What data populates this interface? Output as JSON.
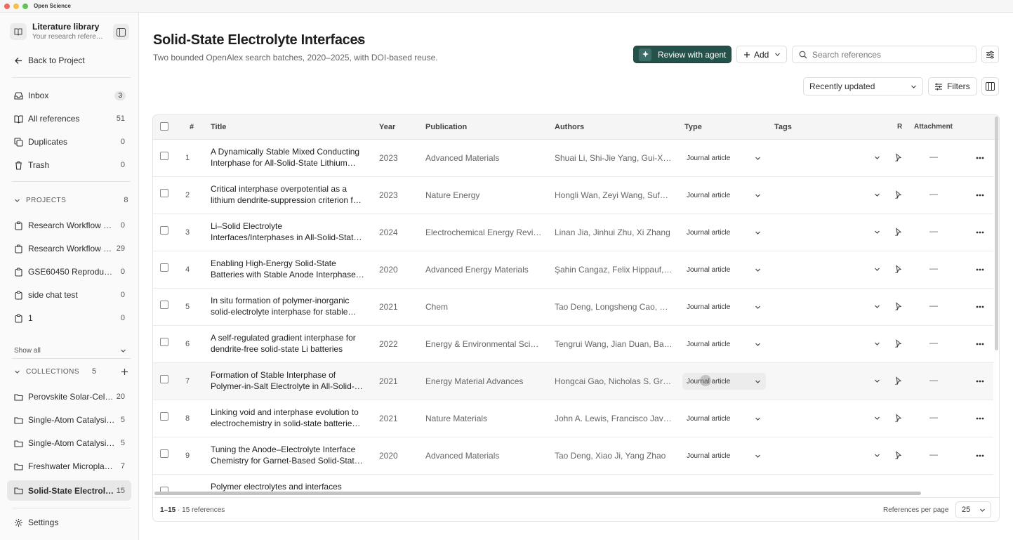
{
  "window": {
    "app_name": "Open Science"
  },
  "sidebar": {
    "library_title": "Literature library",
    "library_subtitle": "Your research refere…",
    "back_label": "Back to Project",
    "nav": [
      {
        "label": "Inbox",
        "count": "3",
        "icon": "inbox-icon"
      },
      {
        "label": "All references",
        "count": "51",
        "icon": "book-icon"
      },
      {
        "label": "Duplicates",
        "count": "0",
        "icon": "copy-icon"
      },
      {
        "label": "Trash",
        "count": "0",
        "icon": "trash-icon"
      }
    ],
    "projects_header": "PROJECTS",
    "projects_count": "8",
    "projects": [
      {
        "label": "Research Workflow E…",
        "count": "0"
      },
      {
        "label": "Research Workflow …",
        "count": "29"
      },
      {
        "label": "GSE60450 Reproduci…",
        "count": "0"
      },
      {
        "label": "side chat test",
        "count": "0"
      },
      {
        "label": "1",
        "count": "0"
      }
    ],
    "show_all": "Show all",
    "collections_header": "COLLECTIONS",
    "collections_count": "5",
    "collections": [
      {
        "label": "Perovskite Solar-Cel…",
        "count": "20"
      },
      {
        "label": "Single-Atom Catalysi…",
        "count": "5"
      },
      {
        "label": "Single-Atom Catalysi…",
        "count": "5"
      },
      {
        "label": "Freshwater Microplas…",
        "count": "7"
      },
      {
        "label": "Solid-State Electrol…",
        "count": "15",
        "active": true
      }
    ],
    "settings_label": "Settings"
  },
  "header": {
    "title": "Solid-State Electrolyte Interfaces",
    "subtitle": "Two bounded OpenAlex search batches, 2020–2025, with DOI-based reuse.",
    "agent_button": "Review with agent",
    "add_button": "Add",
    "search_placeholder": "Search references",
    "sort_value": "Recently updated",
    "filters_button": "Filters"
  },
  "table": {
    "columns": {
      "num": "#",
      "title": "Title",
      "year": "Year",
      "publication": "Publication",
      "authors": "Authors",
      "type": "Type",
      "tags": "Tags",
      "r": "R",
      "attachment": "Attachment"
    },
    "rows": [
      {
        "num": "1",
        "title1": "A Dynamically Stable Mixed Conducting",
        "title2": "Interphase for All-Solid-State Lithium…",
        "year": "2023",
        "publication": "Advanced Materials",
        "authors": "Shuai Li, Shi-Jie Yang, Gui-Xi…",
        "type": "Journal article",
        "attachment": "—"
      },
      {
        "num": "2",
        "title1": "Critical interphase overpotential as a",
        "title2": "lithium dendrite-suppression criterion f…",
        "year": "2023",
        "publication": "Nature Energy",
        "authors": "Hongli Wan, Zeyi Wang, Sufu…",
        "type": "Journal article",
        "attachment": "—"
      },
      {
        "num": "3",
        "title1": "Li–Solid Electrolyte",
        "title2": "Interfaces/Interphases in All-Solid-Stat…",
        "year": "2024",
        "publication": "Electrochemical Energy Revi…",
        "authors": "Linan Jia, Jinhui Zhu, Xi Zhang",
        "type": "Journal article",
        "attachment": "—"
      },
      {
        "num": "4",
        "title1": "Enabling High-Energy Solid-State",
        "title2": "Batteries with Stable Anode Interphase…",
        "year": "2020",
        "publication": "Advanced Energy Materials",
        "authors": "Şahin Cangaz, Felix Hippauf, …",
        "type": "Journal article",
        "attachment": "—"
      },
      {
        "num": "5",
        "title1": "In situ formation of polymer-inorganic",
        "title2": "solid-electrolyte interphase for stable…",
        "year": "2021",
        "publication": "Chem",
        "authors": "Tao Deng, Longsheng Cao, X…",
        "type": "Journal article",
        "attachment": "—"
      },
      {
        "num": "6",
        "title1": "A self-regulated gradient interphase for",
        "title2": "dendrite-free solid-state Li batteries",
        "year": "2022",
        "publication": "Energy & Environmental Scie…",
        "authors": "Tengrui Wang, Jian Duan, Ba…",
        "type": "Journal article",
        "attachment": "—"
      },
      {
        "num": "7",
        "title1": "Formation of Stable Interphase of",
        "title2": "Polymer-in-Salt Electrolyte in All-Solid-…",
        "year": "2021",
        "publication": "Energy Material Advances",
        "authors": "Hongcai Gao, Nicholas S. Gr…",
        "type": "Journal article",
        "attachment": "—",
        "hover": true
      },
      {
        "num": "8",
        "title1": "Linking void and interphase evolution to",
        "title2": "electrochemistry in solid-state batterie…",
        "year": "2021",
        "publication": "Nature Materials",
        "authors": "John A. Lewis, Francisco Javi…",
        "type": "Journal article",
        "attachment": "—"
      },
      {
        "num": "9",
        "title1": "Tuning the Anode–Electrolyte Interface",
        "title2": "Chemistry for Garnet-Based Solid-Stat…",
        "year": "2020",
        "publication": "Advanced Materials",
        "authors": "Tao Deng, Xiao Ji, Yang Zhao",
        "type": "Journal article",
        "attachment": "—"
      },
      {
        "num": "",
        "title1": "Polymer electrolytes and interfaces",
        "title2": "",
        "year": "",
        "publication": "",
        "authors": "",
        "type": "",
        "attachment": ""
      }
    ]
  },
  "footer": {
    "range": "1–15",
    "total": " · 15 references",
    "per_page_label": "References per page",
    "per_page_value": "25"
  }
}
